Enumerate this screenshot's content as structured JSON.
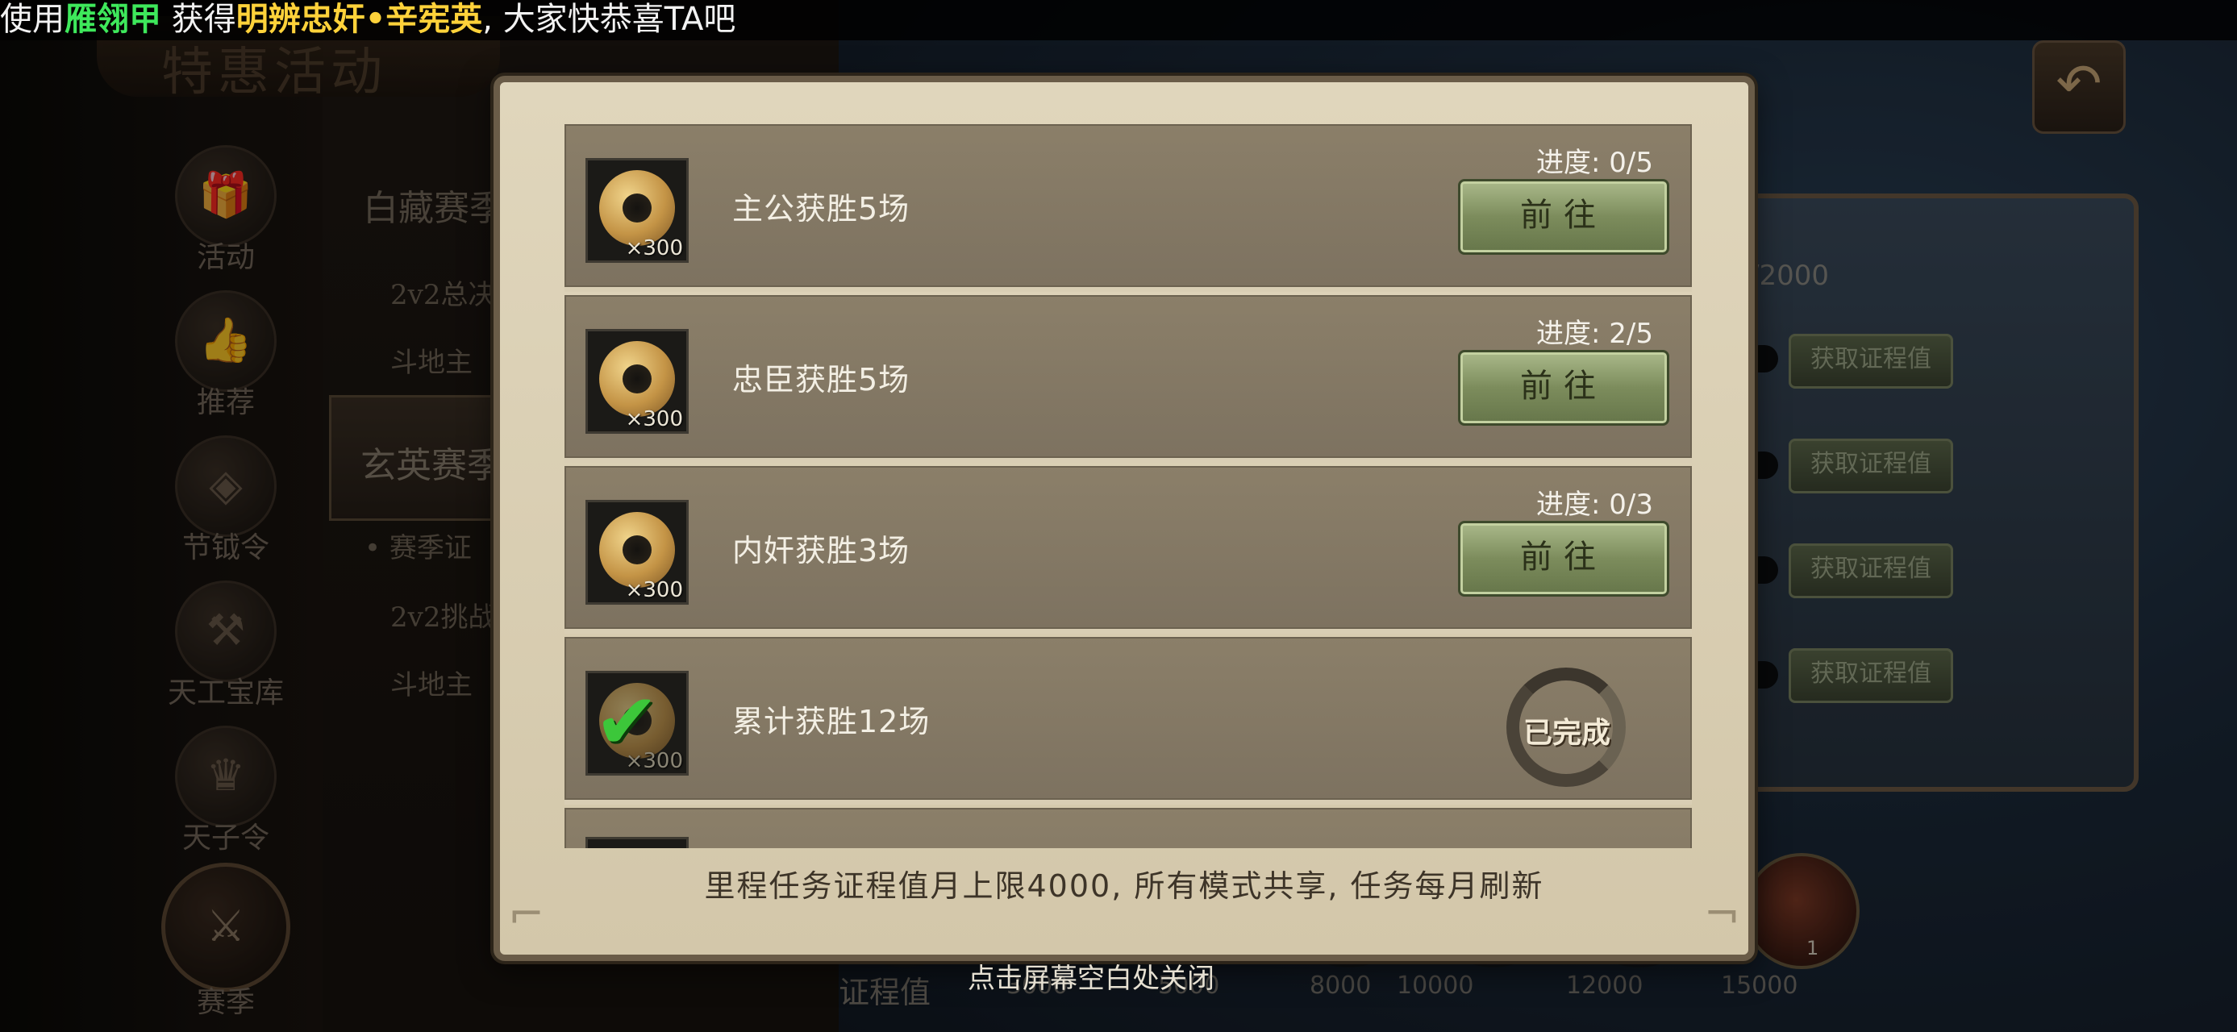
{
  "marquee": {
    "prefix": "使用",
    "item": "雁翎甲",
    "verb": "获得",
    "skin": "明辨忠奸•辛宪英",
    "suffix": ", 大家快恭喜TA吧"
  },
  "background": {
    "banner_title": "特惠活动",
    "rail": [
      {
        "icon": "gift-icon",
        "label": "活动"
      },
      {
        "icon": "thumbs-up-icon",
        "label": "推荐"
      },
      {
        "icon": "festival-icon",
        "label": "节钺令"
      },
      {
        "icon": "workshop-icon",
        "label": "天工宝库"
      },
      {
        "icon": "emperor-icon",
        "label": "天子令"
      },
      {
        "icon": "season-icon",
        "label": "赛季"
      }
    ],
    "submenu": [
      "白藏赛季",
      "2v2总决",
      "斗地主",
      "玄英赛季",
      "• 赛季证",
      "2v2挑战",
      "斗地主"
    ],
    "right_panel": {
      "score_text": "/2000",
      "get_button_label": "获取证程值"
    },
    "milestones": {
      "label": "证程值",
      "values": [
        "3000",
        "5000",
        "8000",
        "10000",
        "12000",
        "15000"
      ]
    },
    "chest_count": "1"
  },
  "dialog": {
    "tasks": [
      {
        "name": "主公获胜5场",
        "reward_qty": "×300",
        "progress": "进度: 0/5",
        "state": "active",
        "button": "前往"
      },
      {
        "name": "忠臣获胜5场",
        "reward_qty": "×300",
        "progress": "进度: 2/5",
        "state": "active",
        "button": "前往"
      },
      {
        "name": "内奸获胜3场",
        "reward_qty": "×300",
        "progress": "进度: 0/3",
        "state": "active",
        "button": "前往"
      },
      {
        "name": "累计获胜12场",
        "reward_qty": "×300",
        "progress": "",
        "state": "done",
        "done_label": "已完成"
      }
    ],
    "footer": "里程任务证程值月上限4000, 所有模式共享, 任务每月刷新"
  },
  "close_hint": "点击屏幕空白处关闭",
  "colors": {
    "marquee_green": "#3ee85b",
    "marquee_yellow": "#ffd23a",
    "goto_button": "#7c8c5c",
    "dialog_bg": "#d3c7aa",
    "task_row": "#847866"
  }
}
